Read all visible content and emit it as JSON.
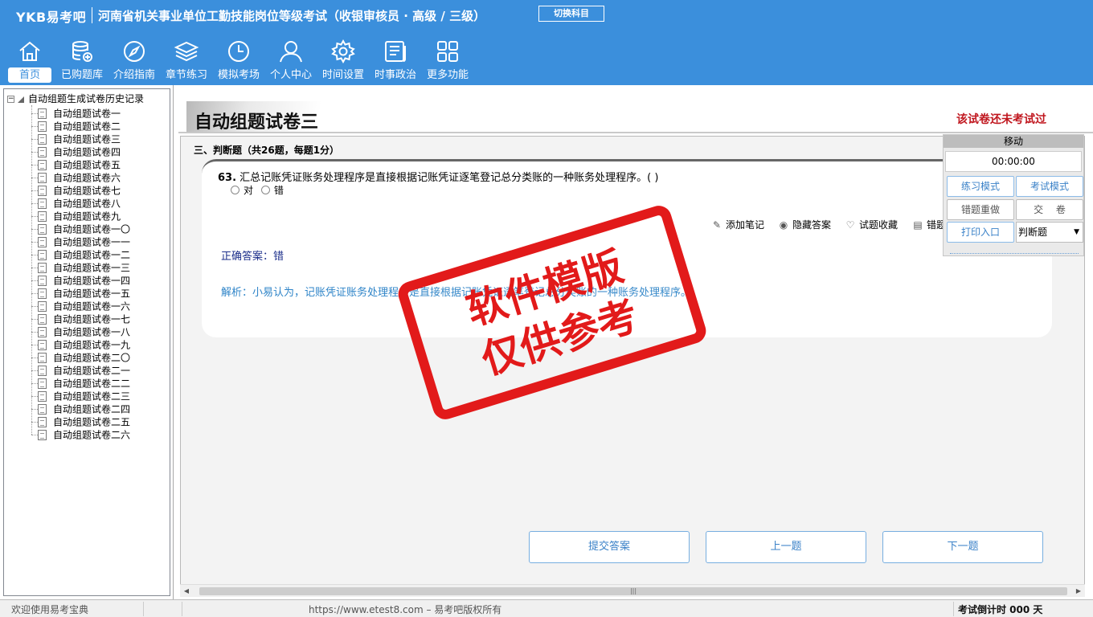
{
  "header": {
    "brand": "YKB易考吧",
    "exam_title": "河南省机关事业单位工勤技能岗位等级考试（收银审核员 · 高级 / 三级）",
    "switch_subject": "切换科目"
  },
  "nav": [
    {
      "label": "首页",
      "icon": "home-icon",
      "active": true
    },
    {
      "label": "已购题库",
      "icon": "database-icon"
    },
    {
      "label": "介绍指南",
      "icon": "compass-icon"
    },
    {
      "label": "章节练习",
      "icon": "layers-icon"
    },
    {
      "label": "模拟考场",
      "icon": "clock-icon"
    },
    {
      "label": "个人中心",
      "icon": "user-icon"
    },
    {
      "label": "时间设置",
      "icon": "gear-icon"
    },
    {
      "label": "时事政治",
      "icon": "news-icon"
    },
    {
      "label": "更多功能",
      "icon": "grid-icon"
    }
  ],
  "tree": {
    "root": "自动组题生成试卷历史记录",
    "items": [
      "自动组题试卷一",
      "自动组题试卷二",
      "自动组题试卷三",
      "自动组题试卷四",
      "自动组题试卷五",
      "自动组题试卷六",
      "自动组题试卷七",
      "自动组题试卷八",
      "自动组题试卷九",
      "自动组题试卷一〇",
      "自动组题试卷一一",
      "自动组题试卷一二",
      "自动组题试卷一三",
      "自动组题试卷一四",
      "自动组题试卷一五",
      "自动组题试卷一六",
      "自动组题试卷一七",
      "自动组题试卷一八",
      "自动组题试卷一九",
      "自动组题试卷二〇",
      "自动组题试卷二一",
      "自动组题试卷二二",
      "自动组题试卷二三",
      "自动组题试卷二四",
      "自动组题试卷二五",
      "自动组题试卷二六"
    ]
  },
  "paper": {
    "title": "自动组题试卷三",
    "status": "该试卷还未考试过"
  },
  "section": {
    "title": "三、判断题（共26题，每题1分）"
  },
  "question": {
    "number": "63.",
    "text": " 汇总记账凭证账务处理程序是直接根据记账凭证逐笔登记总分类账的一种账务处理程序。( )",
    "options": [
      "对",
      "错"
    ],
    "actions": {
      "add_note": "添加笔记",
      "hide_answer": "隐藏答案",
      "favorite": "试题收藏",
      "error": "错题"
    },
    "answer": "正确答案：错",
    "analysis": "解析：小易认为，记账凭证账务处理程序是直接根据记账凭证逐笔登记总分类账的一种账务处理程序。"
  },
  "buttons": {
    "submit": "提交答案",
    "prev": "上一题",
    "next": "下一题"
  },
  "float_panel": {
    "title": "移动",
    "timer": "00:00:00",
    "practice_mode": "练习模式",
    "exam_mode": "考试模式",
    "redo_wrong": "错题重做",
    "hand_in": "交　 卷",
    "print": "打印入口",
    "type_select": "判断题"
  },
  "stamp": {
    "line1": "软件模版",
    "line2": "仅供参考"
  },
  "status_bar": {
    "welcome": "欢迎使用易考宝典",
    "copyright": "https://www.etest8.com – 易考吧版权所有",
    "countdown": "考试倒计时 000 天"
  }
}
